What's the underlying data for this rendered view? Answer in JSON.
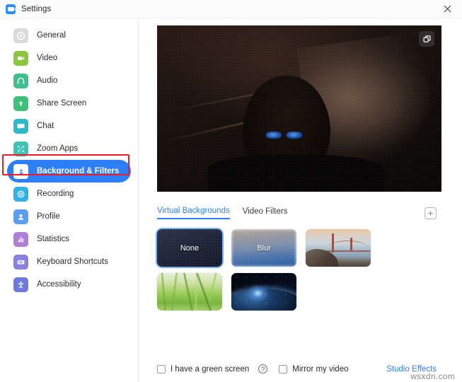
{
  "window": {
    "title": "Settings",
    "app_icon": "zoom-camera-icon",
    "close_label": "×"
  },
  "sidebar": {
    "items": [
      {
        "label": "General",
        "icon": "gear-icon",
        "color": "#d9d9d9",
        "active": false
      },
      {
        "label": "Video",
        "icon": "video-icon",
        "color": "#8cc63f",
        "active": false
      },
      {
        "label": "Audio",
        "icon": "headphones-icon",
        "color": "#3fbf8f",
        "active": false
      },
      {
        "label": "Share Screen",
        "icon": "upload-icon",
        "color": "#3fbf7a",
        "active": false
      },
      {
        "label": "Chat",
        "icon": "chat-icon",
        "color": "#2fb8c6",
        "active": false
      },
      {
        "label": "Zoom Apps",
        "icon": "apps-icon",
        "color": "#3fc4b4",
        "active": false
      },
      {
        "label": "Background & Filters",
        "icon": "person-icon",
        "color": "#2d7ff9",
        "active": true
      },
      {
        "label": "Recording",
        "icon": "record-icon",
        "color": "#2fb0e8",
        "active": false
      },
      {
        "label": "Profile",
        "icon": "profile-icon",
        "color": "#5b9ef0",
        "active": false
      },
      {
        "label": "Statistics",
        "icon": "bar-chart-icon",
        "color": "#b07ed6",
        "active": false
      },
      {
        "label": "Keyboard Shortcuts",
        "icon": "keyboard-icon",
        "color": "#8b7fe0",
        "active": false
      },
      {
        "label": "Accessibility",
        "icon": "accessibility-icon",
        "color": "#6f78dd",
        "active": false
      }
    ],
    "annotation_color": "#ee1c25",
    "active_pill_color": "#2d7ff9"
  },
  "preview": {
    "snapshot_icon": "snapshot-icon"
  },
  "tabs": [
    {
      "label": "Virtual Backgrounds",
      "active": true
    },
    {
      "label": "Video Filters",
      "active": false
    }
  ],
  "add_button": {
    "icon": "plus-icon",
    "label": "+"
  },
  "backgrounds": [
    {
      "label": "None",
      "style": "none",
      "selected": true,
      "name": "background-none"
    },
    {
      "label": "Blur",
      "style": "blur",
      "selected": false,
      "name": "background-blur"
    },
    {
      "label": "",
      "style": "bridge",
      "selected": false,
      "name": "background-golden-gate-bridge"
    },
    {
      "label": "",
      "style": "grass",
      "selected": false,
      "name": "background-grass"
    },
    {
      "label": "",
      "style": "earth",
      "selected": false,
      "name": "background-earth-space"
    }
  ],
  "footer": {
    "green_screen_label": "I have a green screen",
    "green_screen_checked": false,
    "help_icon": "question-mark-icon",
    "help_glyph": "?",
    "mirror_label": "Mirror my video",
    "mirror_checked": false,
    "studio_effects_label": "Studio Effects",
    "studio_effects_color": "#2d7ff9"
  },
  "watermark": "wsxdn.com"
}
